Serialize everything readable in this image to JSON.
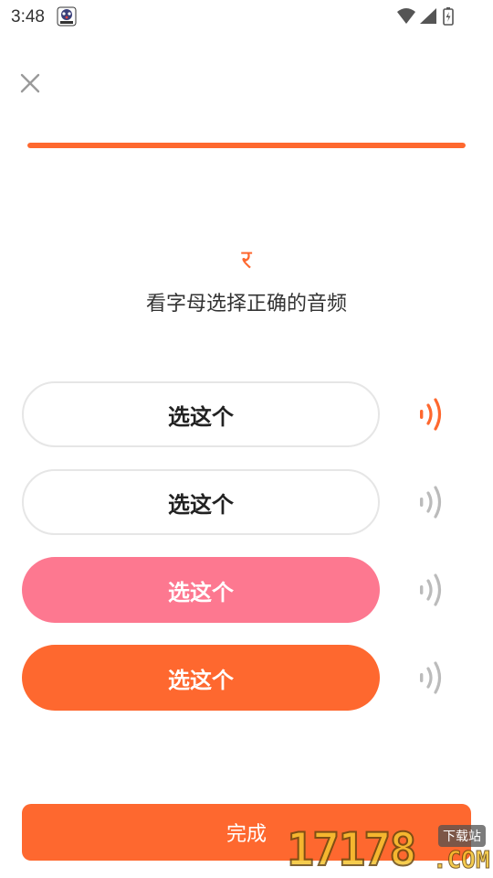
{
  "status_bar": {
    "time": "3:48",
    "app_icon": "app-notification-icon",
    "icons": [
      "wifi-icon",
      "signal-icon",
      "battery-icon"
    ]
  },
  "close_icon": "close-icon",
  "progress": {
    "value": 1.0,
    "color": "#fe682f"
  },
  "question": {
    "letter": "र",
    "instruction": "看字母选择正确的音频"
  },
  "options": [
    {
      "label": "选这个",
      "state": "default",
      "speaker_state": "active"
    },
    {
      "label": "选这个",
      "state": "default",
      "speaker_state": "inactive"
    },
    {
      "label": "选这个",
      "state": "selected-pink",
      "speaker_state": "inactive"
    },
    {
      "label": "选这个",
      "state": "selected-orange",
      "speaker_state": "inactive"
    }
  ],
  "done_button": {
    "label": "完成"
  },
  "watermark": {
    "digits": "17178",
    "suffix": ".COM",
    "badge": "下载站"
  },
  "colors": {
    "accent": "#fe682f",
    "pink": "#fd7890",
    "speaker_inactive": "#bbbbbb",
    "border": "#e6e6e6"
  }
}
